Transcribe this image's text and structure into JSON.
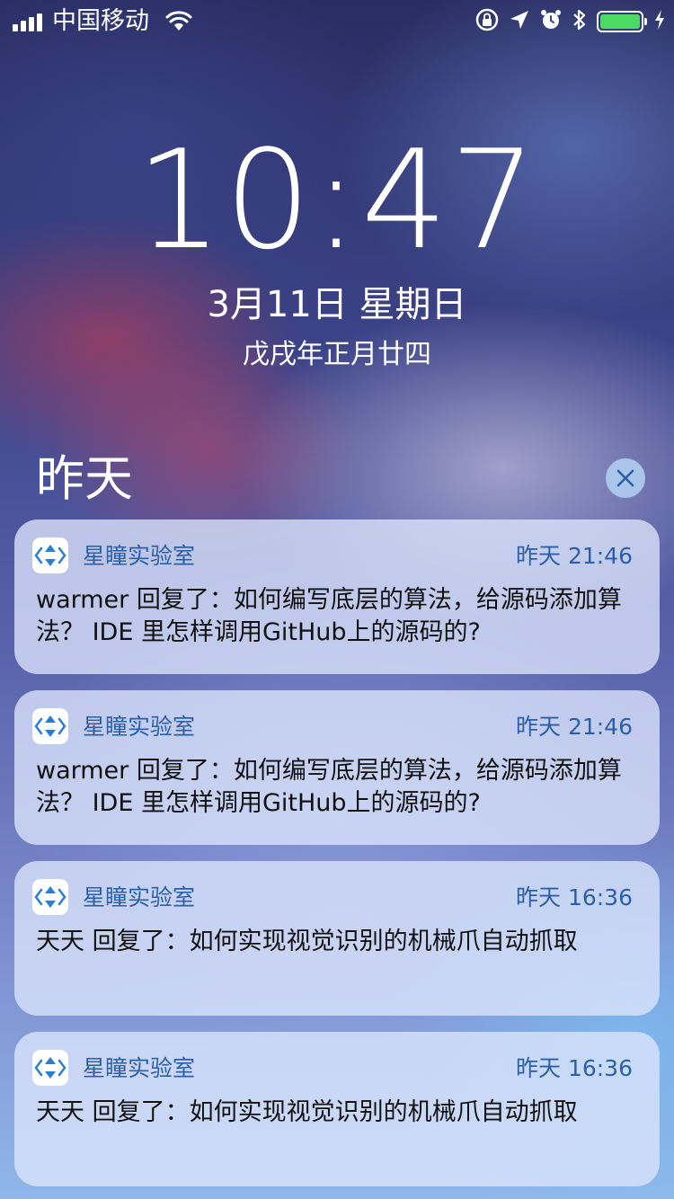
{
  "status_bar": {
    "carrier": "中国移动",
    "signal_bars": 4,
    "wifi": "wifi-icon",
    "icons": [
      "orientation-lock-icon",
      "location-arrow-icon",
      "alarm-icon",
      "bluetooth-icon"
    ],
    "battery_level": 1.0,
    "charging": true,
    "battery_color": "#4cd964"
  },
  "lock_screen": {
    "time": "10:47",
    "date": "3月11日 星期日",
    "lunar_date": "戊戌年正月廿四"
  },
  "notification_center": {
    "section_title": "昨天",
    "clear_icon": "close-icon",
    "accent_color": "#2b5fa8",
    "notifications": [
      {
        "app": "星瞳实验室",
        "time": "昨天 21:46",
        "body": "warmer 回复了：如何编写底层的算法，给源码添加算法？ IDE 里怎样调用GitHub上的源码的?"
      },
      {
        "app": "星瞳实验室",
        "time": "昨天 21:46",
        "body": "warmer 回复了：如何编写底层的算法，给源码添加算法？ IDE 里怎样调用GitHub上的源码的?"
      },
      {
        "app": "星瞳实验室",
        "time": "昨天 16:36",
        "body": "天天 回复了：如何实现视觉识别的机械爪自动抓取"
      },
      {
        "app": "星瞳实验室",
        "time": "昨天 16:36",
        "body": "天天 回复了：如何实现视觉识别的机械爪自动抓取"
      }
    ]
  }
}
